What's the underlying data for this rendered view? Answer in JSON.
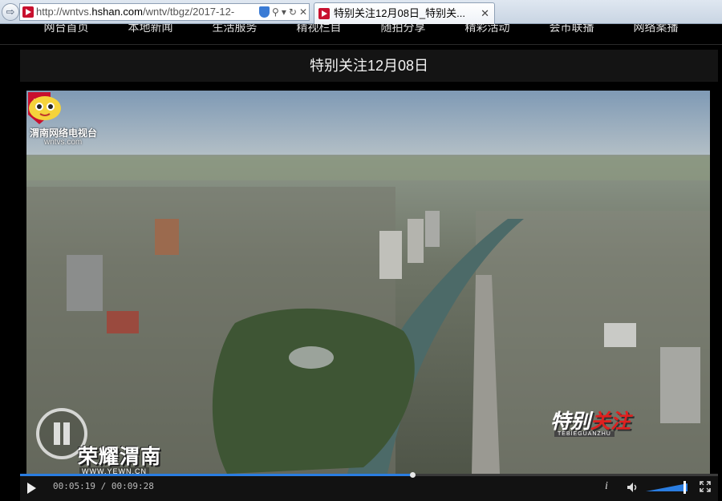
{
  "browser": {
    "url_prefix": "http://wntvs.",
    "url_host": "hshan.com",
    "url_rest": "/wntv/tbgz/2017-12-",
    "tab_title": "特别关注12月08日_特别关..."
  },
  "site_nav": [
    "网台首页",
    "本地新闻",
    "生活服务",
    "精视栏目",
    "随拍分享",
    "精彩活动",
    "会市联播",
    "网络案播"
  ],
  "page": {
    "title": "特别关注12月08日"
  },
  "video": {
    "station_name": "渭南网络电视台",
    "station_url": "wntvs.com",
    "watermark": "荣耀渭南",
    "watermark_url": "WWW.YEWN.CN",
    "program_logo_white": "特别",
    "program_logo_red": "关注",
    "program_logo_sub": "TEBIEGUANZHU"
  },
  "player": {
    "current_time": "00:05:19",
    "duration": "00:09:28",
    "time_separator": " / ",
    "progress": 0.562,
    "volume": 0.92,
    "accent_color": "#2a7de1"
  }
}
